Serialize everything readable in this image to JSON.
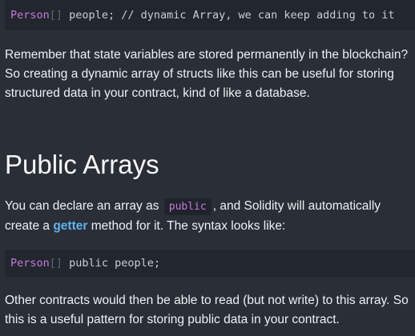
{
  "code_top": {
    "type": "Person",
    "brackets": "[]",
    "rest": " people; // dynamic Array, we can keep adding to it"
  },
  "paragraph1": "Remember that state variables are stored permanently in the blockchain? So creating a dynamic array of structs like this can be useful for storing structured data in your contract, kind of like a database.",
  "heading": "Public Arrays",
  "paragraph2": {
    "before": "You can declare an array as ",
    "code": "public",
    "middle": ", and Solidity will automatically create a ",
    "link": "getter",
    "after": " method for it. The syntax looks like:"
  },
  "code_bottom": {
    "type": "Person",
    "brackets": "[]",
    "rest": " public people;"
  },
  "paragraph3": "Other contracts would then be able to read (but not write) to this array. So this is a useful pattern for storing public data in your contract.",
  "colors": {
    "background": "#2a2f37",
    "code_background": "#22262d",
    "type_keyword": "#c678dd",
    "link": "#61afef"
  }
}
